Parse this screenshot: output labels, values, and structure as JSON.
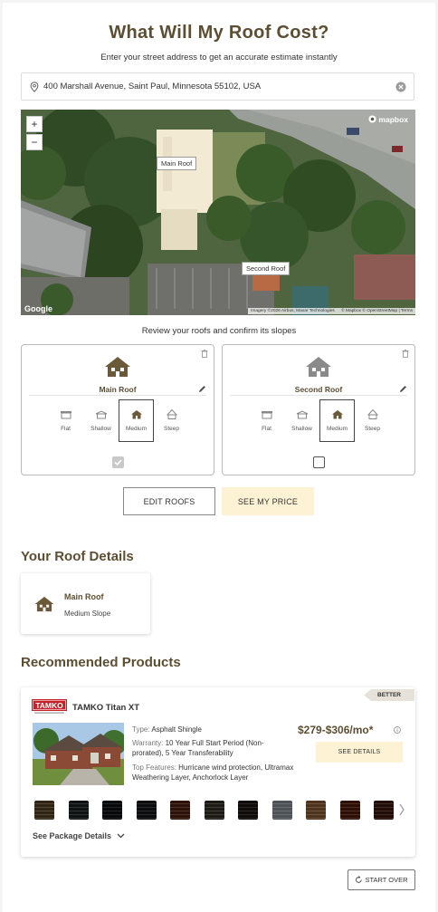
{
  "header": {
    "title": "What Will My Roof Cost?",
    "subtitle": "Enter your street address to get an accurate estimate instantly"
  },
  "search": {
    "value": "400 Marshall Avenue, Saint Paul, Minnesota 55102, USA",
    "icon": "map-pin-icon",
    "clear_icon": "clear-icon"
  },
  "map": {
    "zoom_in": "+",
    "zoom_out": "−",
    "labels": [
      "Main Roof",
      "Second Roof"
    ],
    "mapbox_logo": "mapbox",
    "google_logo": "Google",
    "attribution_left": "Imagery ©2026 Airbus, Maxar Technologies",
    "attribution_right": "© Mapbox © OpenStreetMap | Terms"
  },
  "review": {
    "instruction": "Review your roofs and confirm its slopes"
  },
  "roofs": [
    {
      "name": "Main Roof",
      "icon_color": "#6b5a39",
      "slopes": [
        "Flat",
        "Shallow",
        "Medium",
        "Steep"
      ],
      "selected_slope": "Medium",
      "checked": true
    },
    {
      "name": "Second Roof",
      "icon_color": "#8a8a8a",
      "slopes": [
        "Flat",
        "Shallow",
        "Medium",
        "Steep"
      ],
      "selected_slope": "Medium",
      "checked": false
    }
  ],
  "actions": {
    "edit_roofs": "EDIT ROOFS",
    "see_price": "SEE MY PRICE"
  },
  "roof_details": {
    "heading": "Your Roof Details",
    "items": [
      {
        "name": "Main Roof",
        "slope": "Medium Slope"
      }
    ]
  },
  "products": {
    "heading": "Recommended Products",
    "items": [
      {
        "badge": "BETTER",
        "brand_logo": "TAMKO",
        "name": "TAMKO Titan XT",
        "type_label": "Type:",
        "type": "Asphalt Shingle",
        "warranty_label": "Warranty:",
        "warranty": "10 Year Full Start Period (Non-prorated), 5 Year Transferability",
        "features_label": "Top Features:",
        "features": "Hurricane wind protection, Ultramax Weathering Layer, Anchorlock Layer",
        "price": "$279-$306/mo*",
        "see_details": "SEE DETAILS",
        "swatch_colors": [
          "#6e6048",
          "#3d4446",
          "#2e3133",
          "#35383a",
          "#6b4434",
          "#55524a",
          "#3b3430",
          "#8c9194",
          "#8f7256",
          "#6a3f2e",
          "#5a3a30"
        ],
        "package_details": "See Package Details"
      }
    ]
  },
  "footer": {
    "start_over": "START OVER"
  },
  "colors": {
    "brand": "#5c4e32",
    "accent_bg": "#fdf3d4"
  }
}
